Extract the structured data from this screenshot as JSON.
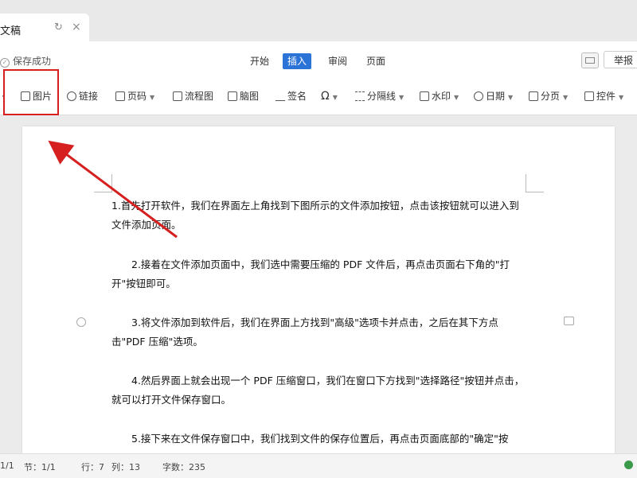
{
  "tab": {
    "title": "文稿",
    "refresh_icon": "refresh-icon",
    "close_icon": "close-icon"
  },
  "menubar": {
    "save_status": "保存成功",
    "tabs": [
      "开始",
      "插入",
      "审阅",
      "页面"
    ],
    "active_tab": "插入",
    "accent_color": "#2b73d6",
    "report_label": "举报"
  },
  "toolbar": {
    "items": [
      {
        "label": "图片",
        "icon": "image-icon"
      },
      {
        "label": "链接",
        "icon": "link-icon"
      },
      {
        "label": "页码",
        "icon": "page-number-icon"
      },
      {
        "label": "流程图",
        "icon": "flowchart-icon"
      },
      {
        "label": "脑图",
        "icon": "mindmap-icon"
      },
      {
        "label": "签名",
        "icon": "signature-icon"
      },
      {
        "label": "Ω",
        "icon": "symbol-icon"
      },
      {
        "label": "分隔线",
        "icon": "divider-icon"
      },
      {
        "label": "水印",
        "icon": "watermark-icon"
      },
      {
        "label": "日期",
        "icon": "date-icon"
      },
      {
        "label": "分页",
        "icon": "page-break-icon"
      },
      {
        "label": "控件",
        "icon": "control-icon"
      }
    ]
  },
  "document": {
    "paragraphs": [
      "1.首先打开软件，我们在界面左上角找到下图所示的文件添加按钮，点击该按钮就可以进入到文件添加页面。",
      "2.接着在文件添加页面中，我们选中需要压缩的 PDF 文件后，再点击页面右下角的\"打开\"按钮即可。",
      "3.将文件添加到软件后，我们在界面上方找到\"高级\"选项卡并点击，之后在其下方点击\"PDF 压缩\"选项。",
      "4.然后界面上就会出现一个 PDF 压缩窗口，我们在窗口下方找到\"选择路径\"按钮并点击，就可以打开文件保存窗口。",
      "5.接下来在文件保存窗口中，我们找到文件的保存位置后，再点击页面底部的\"确定\"按"
    ]
  },
  "statusbar": {
    "page": "1/1",
    "section": "节：1/1",
    "row": "行：7",
    "col": "列：13",
    "chars": "字数：235"
  },
  "annotation": {
    "color": "#d62020"
  }
}
